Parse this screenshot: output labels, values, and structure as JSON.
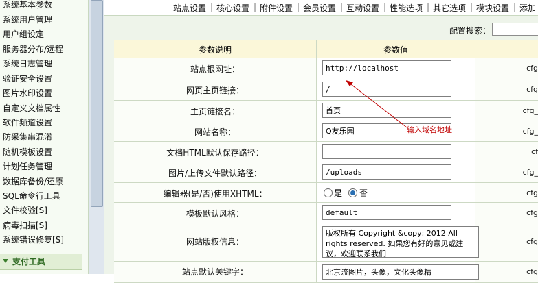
{
  "sidebar": {
    "items": [
      "系统基本参数",
      "系统用户管理",
      "用户组设定",
      "服务器分布/远程",
      "系统日志管理",
      "验证安全设置",
      "图片水印设置",
      "自定义文档属性",
      "软件频道设置",
      "防采集串混淆",
      "随机模板设置",
      "计划任务管理",
      "数据库备份/还原",
      "SQL命令行工具",
      "文件校验[S]",
      "病毒扫描[S]",
      "系统错误修复[S]"
    ],
    "section_label": "支付工具"
  },
  "topnav": {
    "tabs": [
      "站点设置",
      "核心设置",
      "附件设置",
      "会员设置",
      "互动设置",
      "性能选项",
      "其它选项",
      "模块设置",
      "添加"
    ]
  },
  "search": {
    "label": "配置搜索：",
    "value": ""
  },
  "table": {
    "header": {
      "col1": "参数说明",
      "col2": "参数值",
      "col3": ""
    },
    "rows": [
      {
        "label": "站点根网址：",
        "value": "http://localhost",
        "var": "cfg"
      },
      {
        "label": "网页主页链接：",
        "value": "/",
        "var": "cfg"
      },
      {
        "label": "主页链接名：",
        "value": "首页",
        "var": "cfg_"
      },
      {
        "label": "网站名称：",
        "value": "Q友乐园",
        "var": "cfg_"
      },
      {
        "label": "文档HTML默认保存路径：",
        "value": "",
        "var": "cf"
      },
      {
        "label": "图片/上传文件默认路径：",
        "value": "/uploads",
        "var": "cfg_"
      },
      {
        "label": "编辑器(是/否)使用XHTML：",
        "radio_yes": "是",
        "radio_no": "否",
        "var": "cfg"
      },
      {
        "label": "模板默认风格：",
        "value": "default",
        "var": "cfg"
      },
      {
        "label": "网站版权信息：",
        "value": "版权所有 Copyright &copy; 2012 All rights reserved. 如果您有好的意见或建议，欢迎联系我们",
        "var": "cfg"
      },
      {
        "label": "站点默认关键字：",
        "value": "北京流图片，头像，文化头像精",
        "var": "cfg"
      }
    ]
  },
  "annotation": {
    "text": "输入域名地址"
  },
  "colors": {
    "sidebar_bg": "#f6fbf3",
    "header_bg": "#fbf7d9",
    "annotation": "#c00000",
    "radio_on": "#2a6fb2"
  }
}
